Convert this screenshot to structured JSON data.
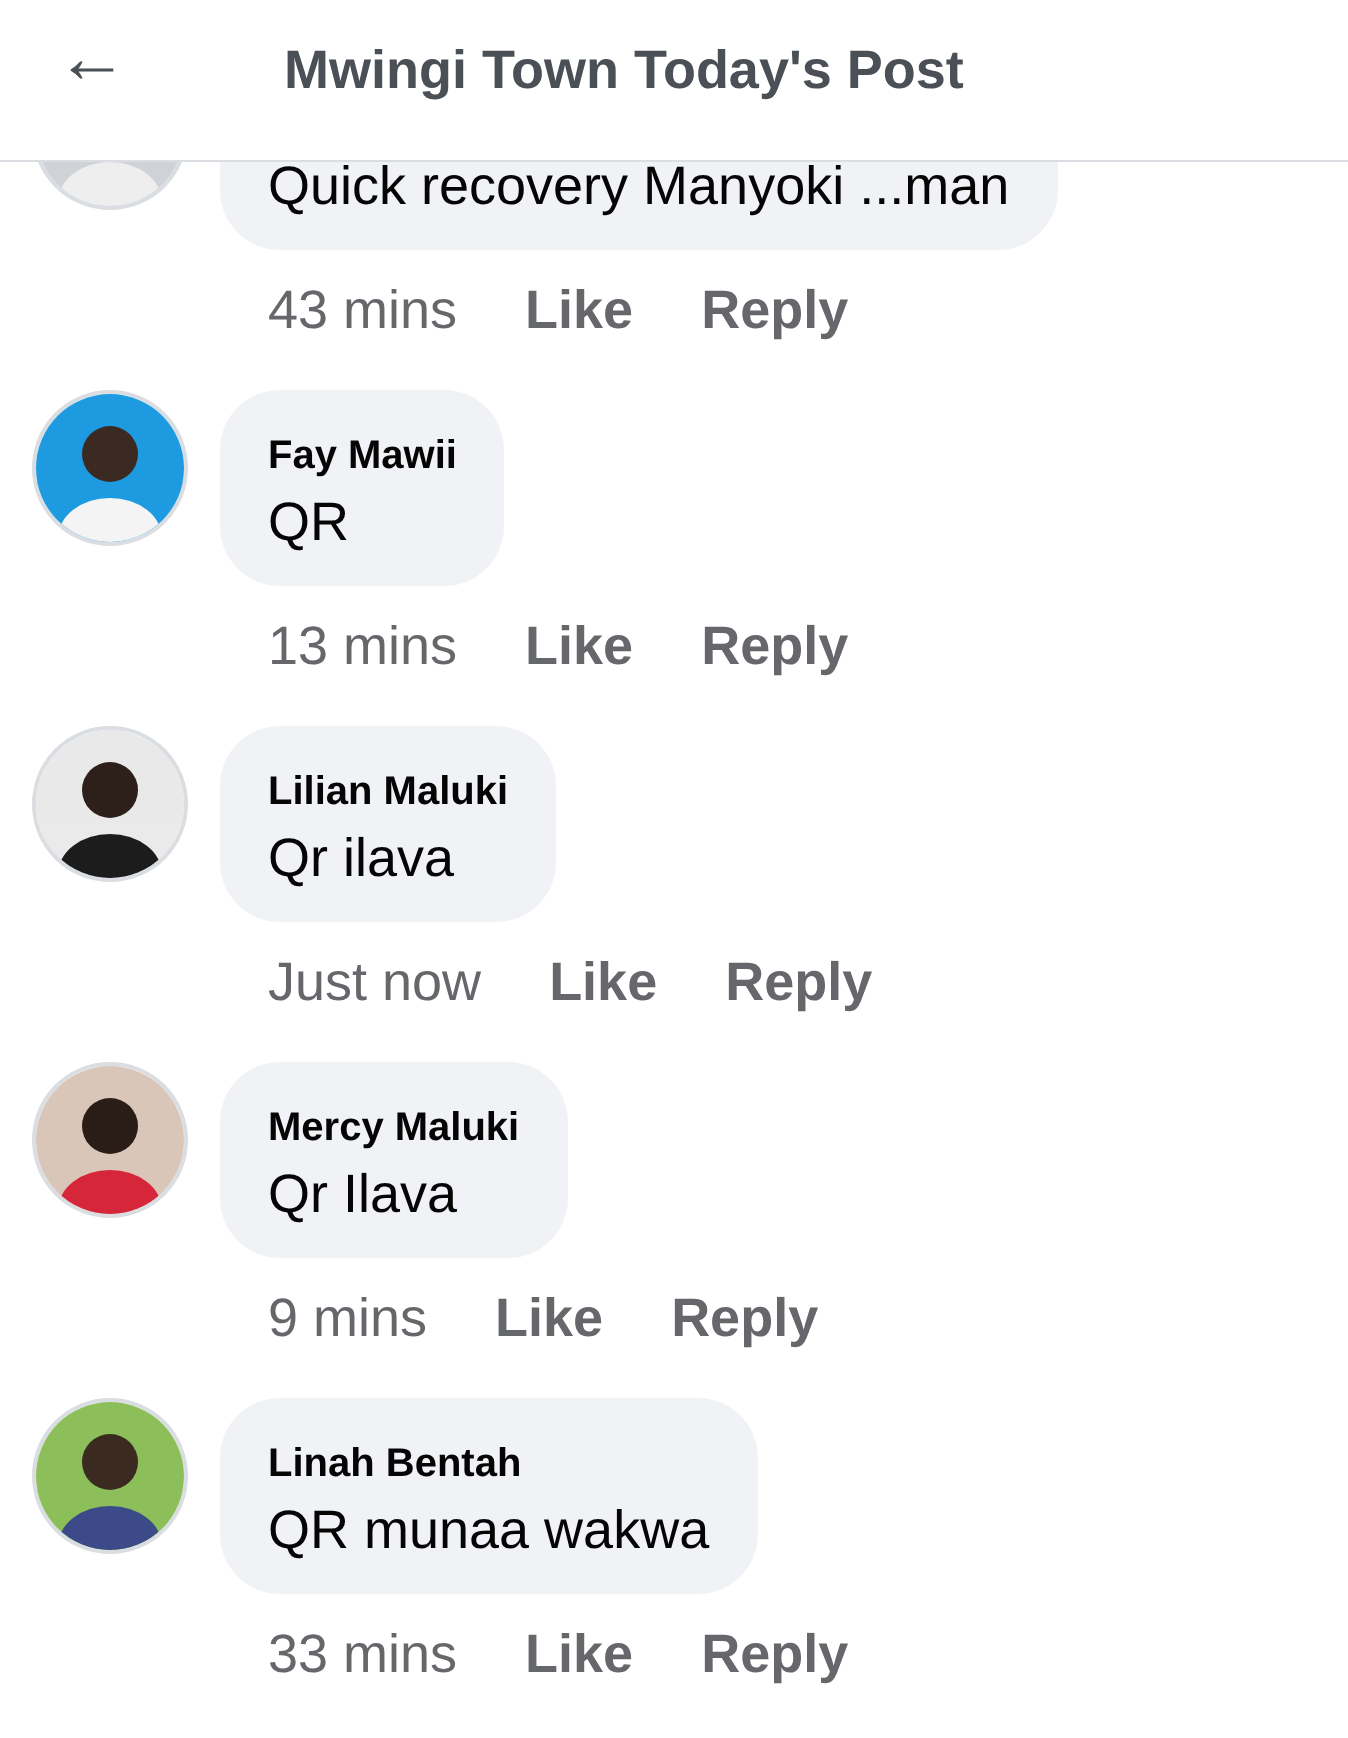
{
  "header": {
    "back_glyph": "←",
    "title": "Mwingi Town Today's Post"
  },
  "comments": [
    {
      "text": "Quick recovery Manyoki ...man",
      "time": "43 mins",
      "actions": [
        "Like",
        "Reply"
      ]
    },
    {
      "author": "Fay Mawii",
      "text": "QR",
      "time": "13 mins",
      "actions": [
        "Like",
        "Reply"
      ]
    },
    {
      "author": "Lilian Maluki",
      "text": "Qr ilava",
      "time": "Just now",
      "actions": [
        "Like",
        "Reply"
      ]
    },
    {
      "author": "Mercy Maluki",
      "text": "Qr Ilava",
      "time": "9 mins",
      "actions": [
        "Like",
        "Reply"
      ]
    },
    {
      "author": "Linah Bentah",
      "text": "QR munaa wakwa",
      "time": "33 mins",
      "actions": [
        "Like",
        "Reply"
      ]
    }
  ]
}
